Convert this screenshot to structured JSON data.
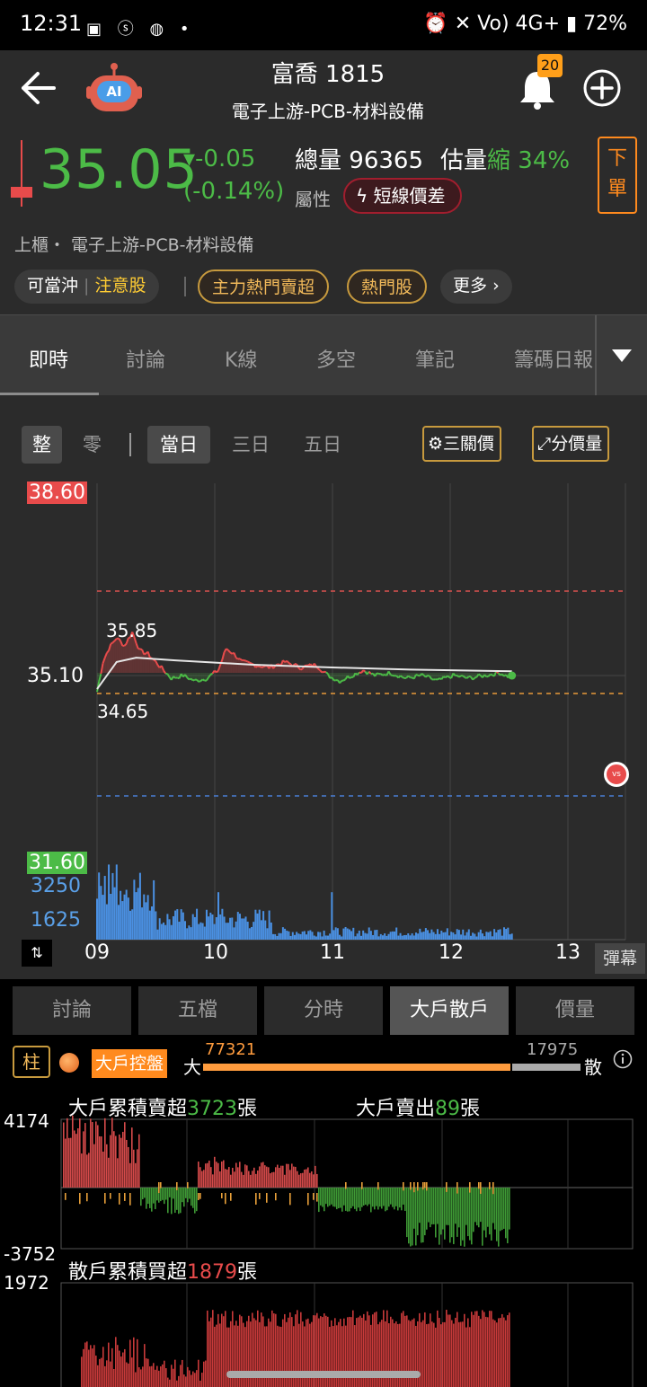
{
  "status": {
    "time": "12:31",
    "left_icons": "▣ ⓢ ◍ •",
    "right": "⏰ ✕ Vo) 4G+ ▮ 72%"
  },
  "header": {
    "title": "富喬 1815",
    "subtitle": "電子上游-PCB-材料設備",
    "robot_label": "AI",
    "notify_count": "20"
  },
  "quote": {
    "price": "35.05",
    "change": "▾-0.05",
    "change_pct": "(-0.14%)",
    "volume_label": "總量",
    "volume": "96365",
    "est_label": "估量",
    "est_status": "縮",
    "est_pct": "34%",
    "attr_label": "屬性",
    "attr_tag": "短線價差",
    "order_btn": "下單",
    "market_line": "上櫃・ 電子上游-PCB-材料設備",
    "pills": {
      "daytrade": "可當沖",
      "attention": "注意股",
      "main_force": "主力熱門賣超",
      "hot": "熱門股",
      "more": "更多"
    }
  },
  "tabs": [
    "即時",
    "討論",
    "K線",
    "多空",
    "筆記",
    "籌碼日報"
  ],
  "chart_controls": {
    "lot_whole": "整",
    "lot_odd": "零",
    "range": [
      "當日",
      "三日",
      "五日"
    ],
    "three_price": "三關價",
    "price_volume": "分價量"
  },
  "chart_labels": {
    "limit_up": "38.60",
    "ref": "35.10",
    "limit_down": "31.60",
    "high": "35.85",
    "low": "34.65",
    "vol_top": "3250",
    "vol_mid": "1625",
    "x_ticks": [
      "09",
      "10",
      "11",
      "12",
      "13"
    ],
    "danmaku": "彈幕"
  },
  "chart_data": {
    "type": "line",
    "x_range": [
      "09:00",
      "13:30"
    ],
    "ylim": [
      31.6,
      38.6
    ],
    "reference": 35.1,
    "high": 35.85,
    "low": 34.65,
    "last": 35.05,
    "price_series": [
      {
        "t": 0,
        "p": 34.75
      },
      {
        "t": 3,
        "p": 35.3
      },
      {
        "t": 6,
        "p": 35.55
      },
      {
        "t": 10,
        "p": 35.75
      },
      {
        "t": 14,
        "p": 35.6
      },
      {
        "t": 18,
        "p": 35.85
      },
      {
        "t": 22,
        "p": 35.5
      },
      {
        "t": 26,
        "p": 35.45
      },
      {
        "t": 30,
        "p": 35.3
      },
      {
        "t": 34,
        "p": 35.15
      },
      {
        "t": 38,
        "p": 35.0
      },
      {
        "t": 44,
        "p": 35.05
      },
      {
        "t": 50,
        "p": 34.95
      },
      {
        "t": 56,
        "p": 35.0
      },
      {
        "t": 62,
        "p": 35.15
      },
      {
        "t": 66,
        "p": 35.55
      },
      {
        "t": 70,
        "p": 35.45
      },
      {
        "t": 74,
        "p": 35.3
      },
      {
        "t": 80,
        "p": 35.25
      },
      {
        "t": 88,
        "p": 35.2
      },
      {
        "t": 96,
        "p": 35.3
      },
      {
        "t": 104,
        "p": 35.2
      },
      {
        "t": 112,
        "p": 35.25
      },
      {
        "t": 118,
        "p": 35.05
      },
      {
        "t": 124,
        "p": 34.95
      },
      {
        "t": 130,
        "p": 35.05
      },
      {
        "t": 136,
        "p": 35.15
      },
      {
        "t": 142,
        "p": 35.05
      },
      {
        "t": 150,
        "p": 35.1
      },
      {
        "t": 158,
        "p": 35.0
      },
      {
        "t": 166,
        "p": 35.05
      },
      {
        "t": 174,
        "p": 34.95
      },
      {
        "t": 182,
        "p": 35.05
      },
      {
        "t": 190,
        "p": 35.0
      },
      {
        "t": 198,
        "p": 35.05
      },
      {
        "t": 206,
        "p": 35.1
      },
      {
        "t": 212,
        "p": 35.0
      },
      {
        "t": 206,
        "p": 35.1
      }
    ],
    "avg_price_series": [
      {
        "t": 0,
        "p": 34.8
      },
      {
        "t": 10,
        "p": 35.3
      },
      {
        "t": 20,
        "p": 35.38
      },
      {
        "t": 40,
        "p": 35.33
      },
      {
        "t": 80,
        "p": 35.25
      },
      {
        "t": 120,
        "p": 35.2
      },
      {
        "t": 160,
        "p": 35.16
      },
      {
        "t": 212,
        "p": 35.13
      }
    ],
    "volume_max": 3250
  },
  "subtabs": [
    "討論",
    "五檔",
    "分時",
    "大戶散戶",
    "價量"
  ],
  "bottom": {
    "col_btn": "柱",
    "holder_tag": "大戶控盤",
    "big_label": "大",
    "big_value": "77321",
    "small_value": "17975",
    "small_label": "散",
    "big_cum_prefix": "大戶累積賣超",
    "big_cum_value": "3723",
    "unit": "張",
    "big_sell_prefix": "大戶賣出",
    "big_sell_value": "89",
    "y_top": "4174",
    "y_bottom": "-3752",
    "retail_y_top": "1972",
    "retail_prefix": "散戶累積買超",
    "retail_value": "1879"
  },
  "colors": {
    "up": "#e84b4b",
    "down": "#4cbb47",
    "accent": "#ff8a1e",
    "panel": "#2b2b2b"
  }
}
